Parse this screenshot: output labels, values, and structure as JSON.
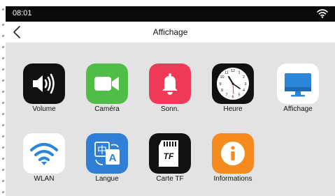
{
  "status": {
    "time": "08:01"
  },
  "nav": {
    "title": "Affichage"
  },
  "apps": [
    {
      "label": "Volume",
      "icon": "volume-icon",
      "color": "#111111"
    },
    {
      "label": "Caméra",
      "icon": "camera-icon",
      "color": "#4fbe47"
    },
    {
      "label": "Sonn.",
      "icon": "bell-icon",
      "color": "#ee3a57"
    },
    {
      "label": "Heure",
      "icon": "clock-icon",
      "color": "#111111"
    },
    {
      "label": "Affichage",
      "icon": "display-icon",
      "color": "#ffffff"
    },
    {
      "label": "WLAN",
      "icon": "wifi-icon",
      "color": "#ffffff"
    },
    {
      "label": "Langue",
      "icon": "language-icon",
      "color": "#2f7fd6"
    },
    {
      "label": "Carte TF",
      "icon": "sd-card-icon",
      "color": "#111111"
    },
    {
      "label": "Informations",
      "icon": "info-icon",
      "color": "#f58a1f"
    }
  ],
  "clock_numbers": [
    "12",
    "1",
    "2",
    "3",
    "4",
    "5",
    "6",
    "7",
    "8",
    "9",
    "10",
    "11"
  ],
  "sd_label": "TF",
  "language_glyphs": {
    "left": "中",
    "right": "A"
  }
}
